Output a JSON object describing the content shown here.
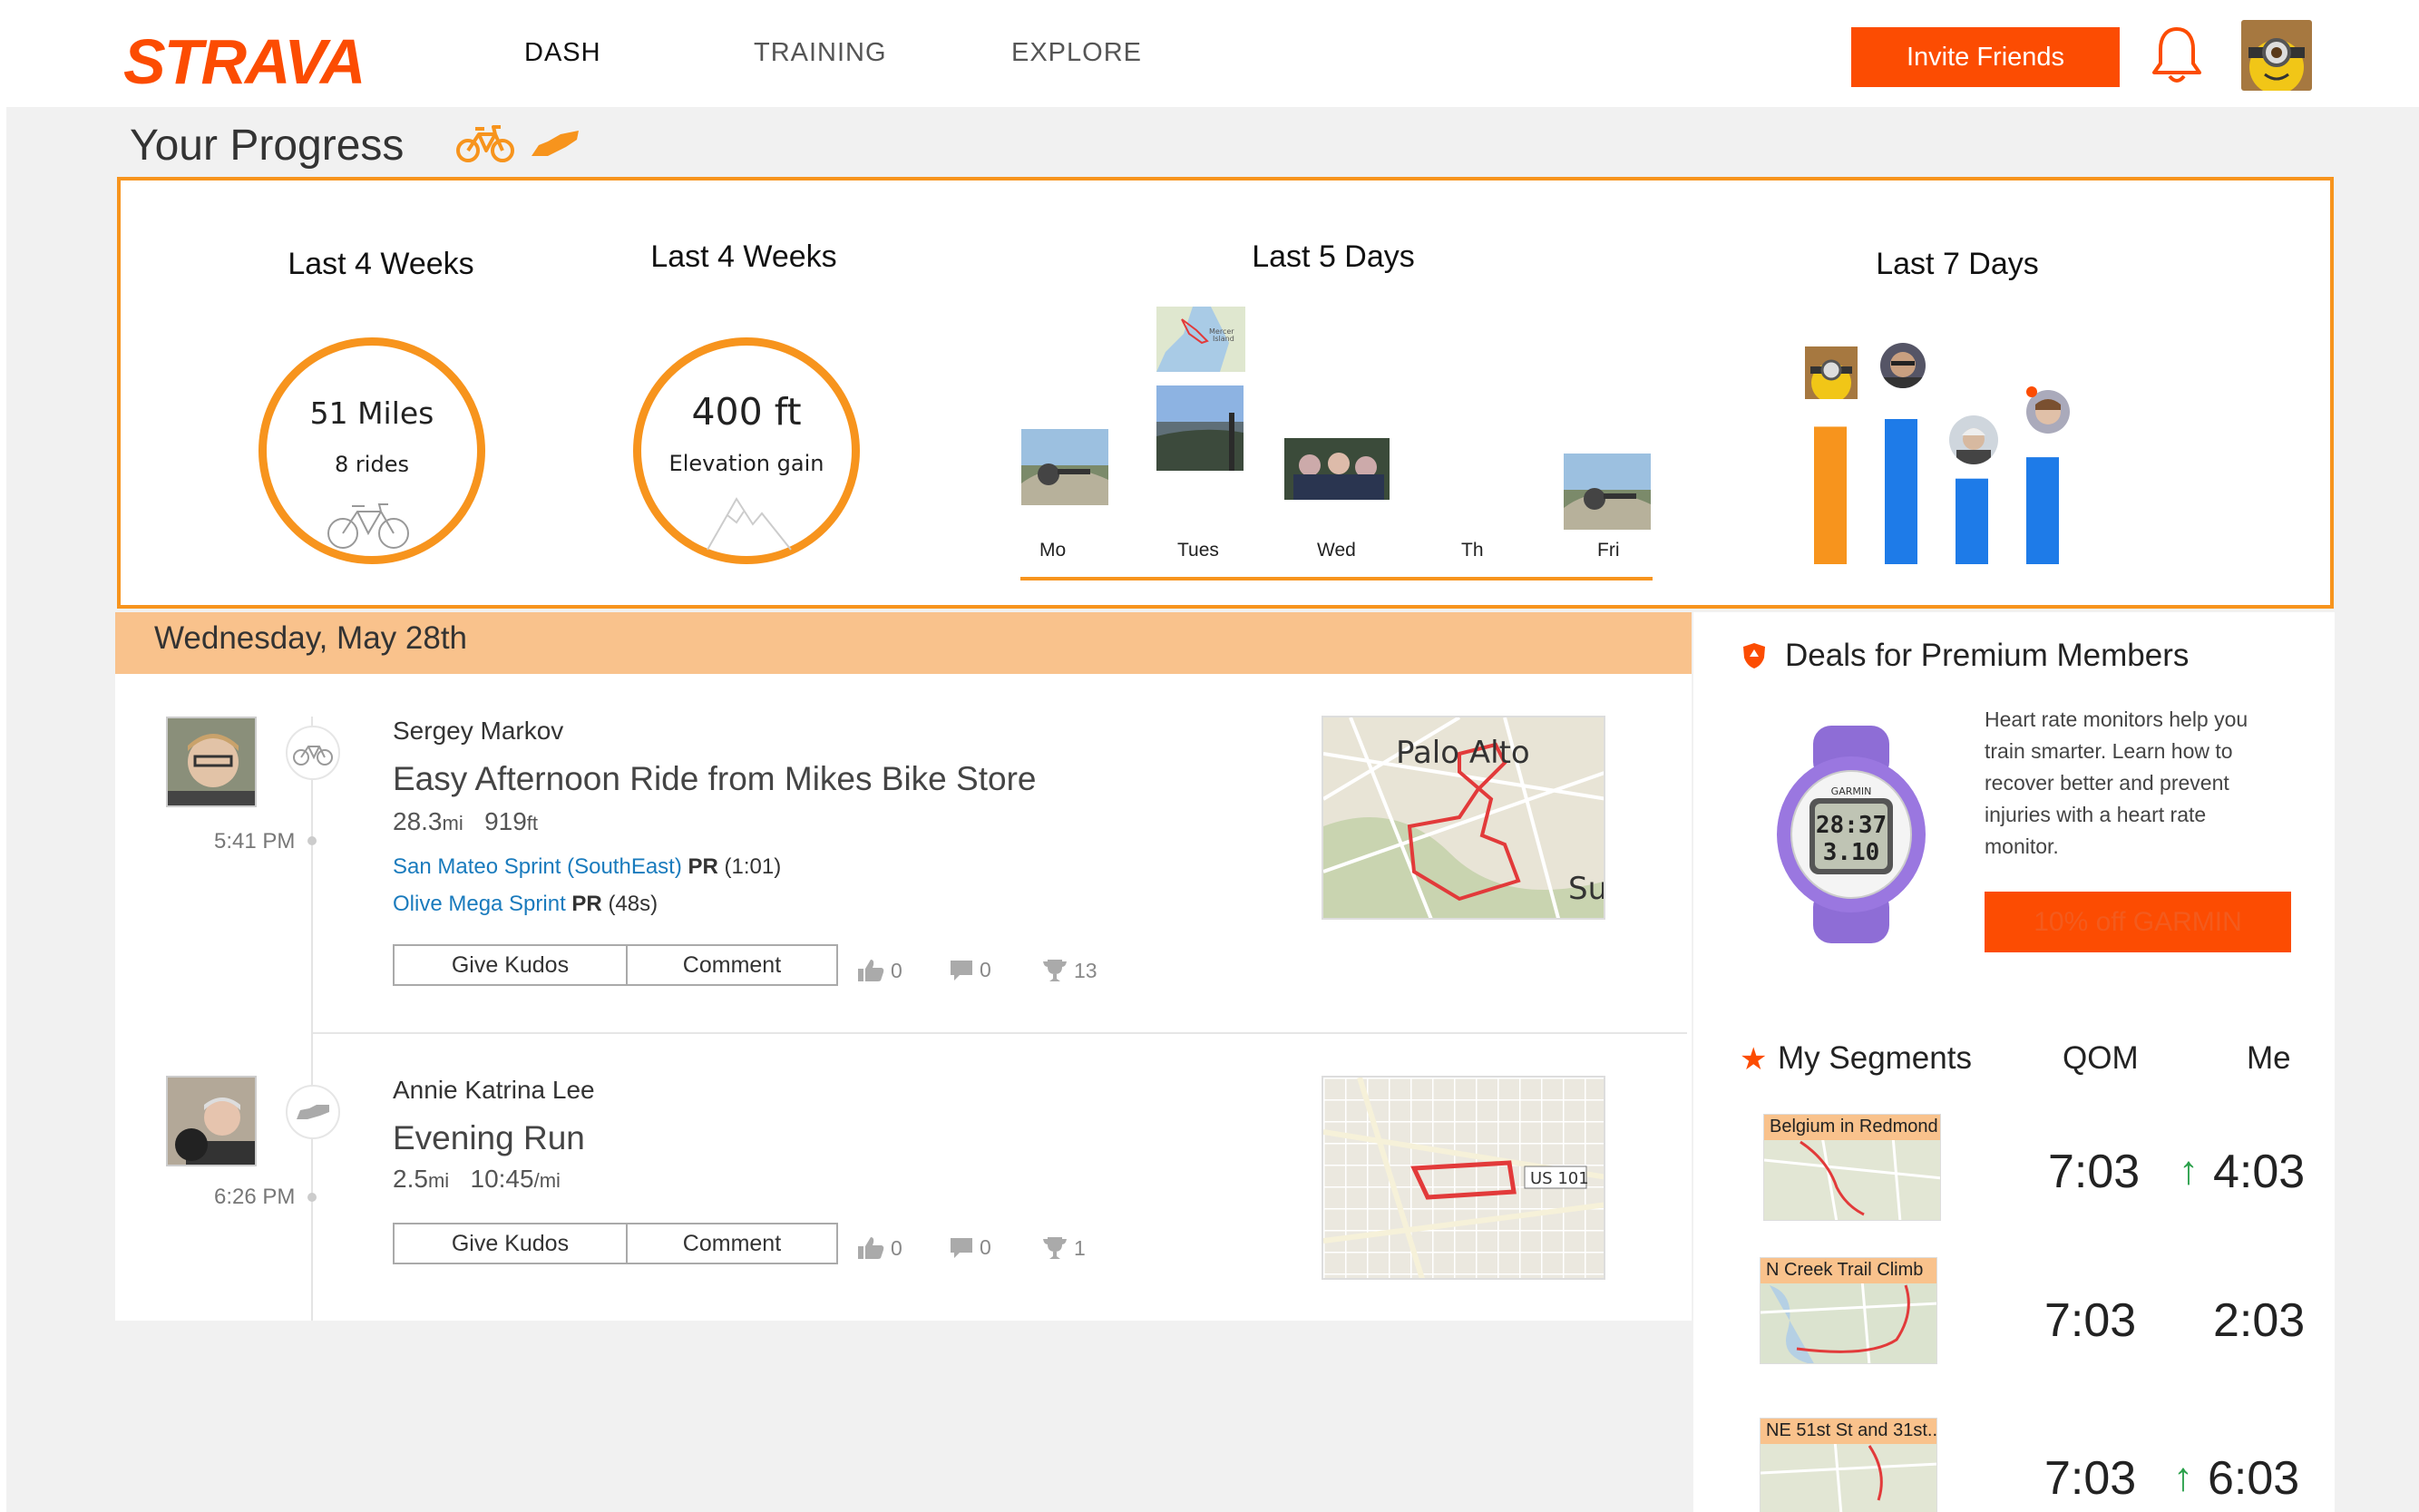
{
  "header": {
    "logo": "STRAVA",
    "nav": [
      "DASH",
      "TRAINING",
      "EXPLORE"
    ],
    "invite_label": "Invite Friends",
    "icons": [
      "bell-icon",
      "avatar"
    ]
  },
  "progress": {
    "title": "Your Progress",
    "toggles": [
      "bike-icon",
      "shoe-icon"
    ],
    "distance": {
      "title": "Last 4 Weeks",
      "value": "51  Miles",
      "sub": "8 rides"
    },
    "elevation": {
      "title": "Last 4 Weeks",
      "value": "400  ft",
      "sub": "Elevation gain"
    },
    "days": {
      "title": "Last 5 Days",
      "labels": [
        "Mo",
        "Tues",
        "Wed",
        "Th",
        "Fri"
      ],
      "map_caption": "Mercer Island"
    },
    "friends": {
      "title": "Last 7 Days"
    }
  },
  "chart_data": {
    "type": "bar",
    "title": "Last 7 Days",
    "categories": [
      "",
      "",
      "",
      ""
    ],
    "values": [
      90,
      95,
      56,
      70
    ],
    "colors": [
      "#f7941d",
      "#1e7be8",
      "#1e7be8",
      "#1e7be8"
    ]
  },
  "feed": {
    "date": "Wednesday, May 28th",
    "activities": [
      {
        "athlete": "Sergey Markov",
        "time": "5:41 PM",
        "title": "Easy Afternoon Ride from Mikes Bike Store",
        "distance": "28.3",
        "distance_unit": "mi",
        "elevation": "919",
        "elevation_unit": "ft",
        "segments": [
          {
            "name": "San Mateo Sprint (SouthEast)",
            "badge": "PR",
            "time": "(1:01)"
          },
          {
            "name": "Olive Mega Sprint",
            "badge": "PR",
            "time": "(48s)"
          }
        ],
        "kudos_label": "Give Kudos",
        "comment_label": "Comment",
        "kudos": "0",
        "comments": "0",
        "achievements": "13",
        "map_labels": [
          "Palo Alto",
          "Su"
        ]
      },
      {
        "athlete": "Annie Katrina Lee",
        "time": "6:26 PM",
        "title": "Evening Run",
        "distance": "2.5",
        "distance_unit": "mi",
        "pace": "10:45",
        "pace_unit": "/mi",
        "kudos_label": "Give Kudos",
        "comment_label": "Comment",
        "kudos": "0",
        "comments": "0",
        "achievements": "1",
        "map_labels": [
          "US 101"
        ]
      }
    ]
  },
  "deals": {
    "title": "Deals for Premium Members",
    "text": "Heart rate monitors help you train smarter. Learn how to recover better and prevent injuries with a heart rate monitor.",
    "button": "10% off GARMIN",
    "watch_brand": "GARMIN",
    "watch_time": "28:37",
    "watch_dist": "3.10"
  },
  "segments": {
    "title": "My Segments",
    "qom_header": "QOM",
    "me_header": "Me",
    "rows": [
      {
        "name": "Belgium in Redmond",
        "qom": "7:03",
        "me": "4:03",
        "improved": true
      },
      {
        "name": "N Creek Trail Climb",
        "qom": "7:03",
        "me": "2:03",
        "improved": false
      },
      {
        "name": "NE 51st St and 31st...",
        "qom": "7:03",
        "me": "6:03",
        "improved": true
      }
    ]
  }
}
